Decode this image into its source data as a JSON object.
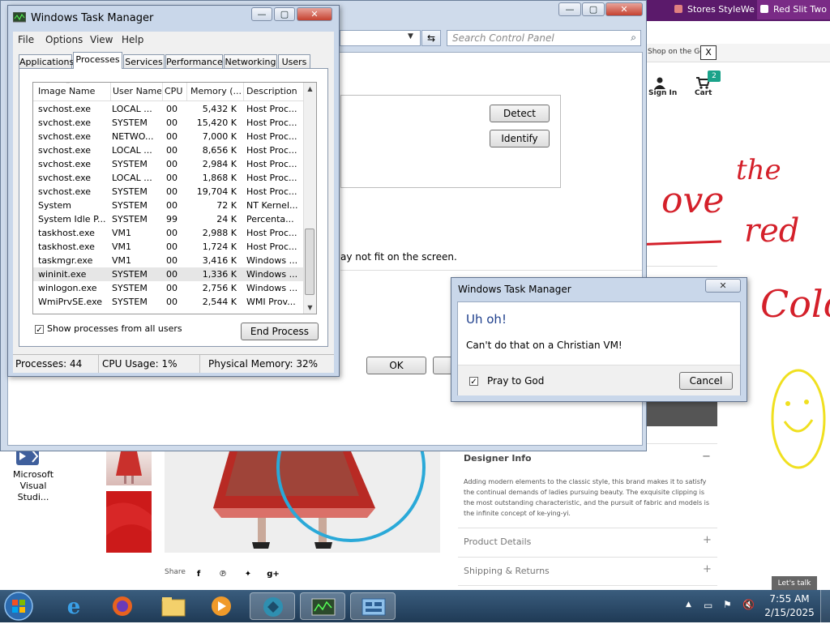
{
  "browser_tabs": [
    {
      "label": "Stores StyleWe Cou"
    },
    {
      "label": "Red Slit Two Pie"
    }
  ],
  "shop": {
    "notice": "Shop on the Go.",
    "close_label": "X",
    "signin_label": "Sign In",
    "cart_label": "Cart",
    "cart_count": "2",
    "designer_info": {
      "title": "Designer Info",
      "toggle": "−",
      "text": "Adding modern elements to the classic style, this brand makes it to satisfy the continual demands of ladies pursuing beauty. The exquisite clipping is the most outstanding characteristic, and the pursuit of fabric and models is the infinite concept of ke-ying-yi."
    },
    "product_details": {
      "title": "Product Details",
      "toggle": "+"
    },
    "shipping": {
      "title": "Shipping & Returns",
      "toggle": "+"
    },
    "share_label": "Share",
    "lets_talk": "Let's talk"
  },
  "control_panel": {
    "search_placeholder": "Search Control Panel",
    "detect_label": "Detect",
    "identify_label": "Identify",
    "message": "ay not fit on the screen.",
    "ok_label": "OK"
  },
  "task_manager": {
    "title": "Windows Task Manager",
    "menu": [
      "File",
      "Options",
      "View",
      "Help"
    ],
    "tabs": [
      "Applications",
      "Processes",
      "Services",
      "Performance",
      "Networking",
      "Users"
    ],
    "active_tab": "Processes",
    "columns": [
      "Image Name",
      "User Name",
      "CPU",
      "Memory (...",
      "Description"
    ],
    "rows": [
      {
        "name": "svchost.exe",
        "user": "LOCAL ...",
        "cpu": "00",
        "mem": "5,432 K",
        "desc": "Host Proc..."
      },
      {
        "name": "svchost.exe",
        "user": "SYSTEM",
        "cpu": "00",
        "mem": "15,420 K",
        "desc": "Host Proc..."
      },
      {
        "name": "svchost.exe",
        "user": "NETWO...",
        "cpu": "00",
        "mem": "7,000 K",
        "desc": "Host Proc..."
      },
      {
        "name": "svchost.exe",
        "user": "LOCAL ...",
        "cpu": "00",
        "mem": "8,656 K",
        "desc": "Host Proc..."
      },
      {
        "name": "svchost.exe",
        "user": "SYSTEM",
        "cpu": "00",
        "mem": "2,984 K",
        "desc": "Host Proc..."
      },
      {
        "name": "svchost.exe",
        "user": "LOCAL ...",
        "cpu": "00",
        "mem": "1,868 K",
        "desc": "Host Proc..."
      },
      {
        "name": "svchost.exe",
        "user": "SYSTEM",
        "cpu": "00",
        "mem": "19,704 K",
        "desc": "Host Proc..."
      },
      {
        "name": "System",
        "user": "SYSTEM",
        "cpu": "00",
        "mem": "72 K",
        "desc": "NT Kernel..."
      },
      {
        "name": "System Idle P...",
        "user": "SYSTEM",
        "cpu": "99",
        "mem": "24 K",
        "desc": "Percenta..."
      },
      {
        "name": "taskhost.exe",
        "user": "VM1",
        "cpu": "00",
        "mem": "2,988 K",
        "desc": "Host Proc..."
      },
      {
        "name": "taskhost.exe",
        "user": "VM1",
        "cpu": "00",
        "mem": "1,724 K",
        "desc": "Host Proc..."
      },
      {
        "name": "taskmgr.exe",
        "user": "VM1",
        "cpu": "00",
        "mem": "3,416 K",
        "desc": "Windows ..."
      },
      {
        "name": "wininit.exe",
        "user": "SYSTEM",
        "cpu": "00",
        "mem": "1,336 K",
        "desc": "Windows ...",
        "selected": true
      },
      {
        "name": "winlogon.exe",
        "user": "SYSTEM",
        "cpu": "00",
        "mem": "2,756 K",
        "desc": "Windows ..."
      },
      {
        "name": "WmiPrvSE.exe",
        "user": "SYSTEM",
        "cpu": "00",
        "mem": "2,544 K",
        "desc": "WMI Prov..."
      }
    ],
    "show_all_label": "Show processes from all users",
    "show_all_checked": true,
    "end_process_label": "End Process",
    "status": {
      "processes": "Processes: 44",
      "cpu": "CPU Usage: 1%",
      "memory": "Physical Memory: 32%"
    }
  },
  "dialog": {
    "title": "Windows Task Manager",
    "heading": "Uh oh!",
    "message": "Can't do that on a Christian VM!",
    "checkbox_label": "Pray to God",
    "checkbox_checked": true,
    "cancel_label": "Cancel"
  },
  "annotations": {
    "words": [
      "ove",
      "the",
      "red",
      "Colo"
    ],
    "ink_color": "#d4202a",
    "smiley_color": "#f0e020",
    "circle_color": "#2aa9d8"
  },
  "desktop": {
    "icon_label": "Microsoft Visual Studi..."
  },
  "taskbar": {
    "time": "7:55 AM",
    "date": "2/15/2025",
    "apps": [
      "internet-explorer",
      "firefox",
      "file-explorer",
      "media-player",
      "visual-studio",
      "task-manager",
      "control-panel"
    ]
  },
  "colors": {
    "browser_tab_bar": "#5b1a6b",
    "dialog_heading": "#1e3f8c",
    "window_frame": "#c9d7ea",
    "cart_badge": "#1aa38a"
  }
}
